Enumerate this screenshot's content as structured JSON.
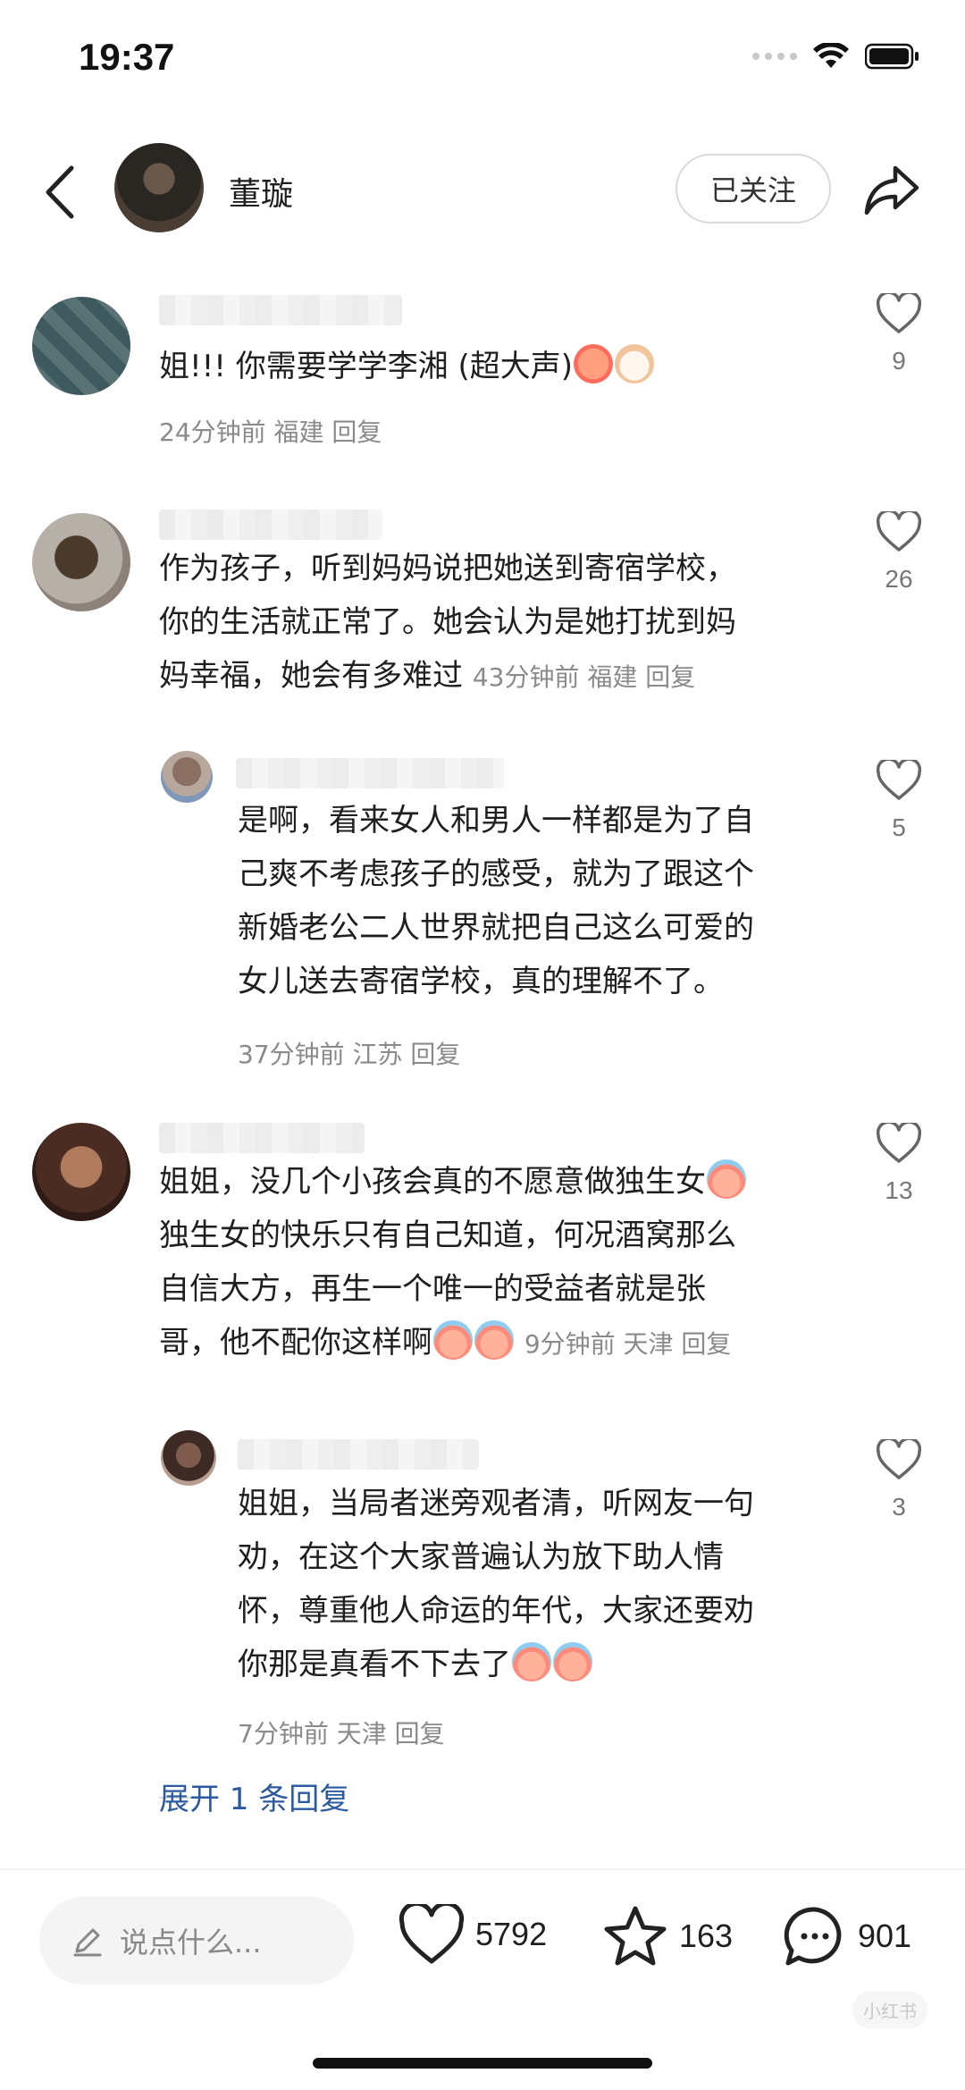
{
  "status_bar": {
    "time": "19:37"
  },
  "header": {
    "user_name": "董璇",
    "follow_label": "已关注"
  },
  "comments": [
    {
      "text_lines": [
        "姐!!! 你需要学学李湘 (超大声)"
      ],
      "meta": "24分钟前 福建 回复",
      "likes": "9",
      "emojis": [
        "tease-face",
        "crying-cat"
      ]
    },
    {
      "text_lines": [
        "作为孩子，听到妈妈说把她送到寄宿学校，",
        "你的生活就正常了。她会认为是她打扰到妈",
        "妈幸福，她会有多难过"
      ],
      "meta": "43分钟前 福建 回复",
      "likes": "26"
    },
    {
      "text_lines": [
        "是啊，看来女人和男人一样都是为了自",
        "己爽不考虑孩子的感受，就为了跟这个",
        "新婚老公二人世界就把自己这么可爱的",
        "女儿送去寄宿学校，真的理解不了。"
      ],
      "meta": "37分钟前 江苏 回复",
      "likes": "5"
    },
    {
      "text_lines": [
        "姐姐，没几个小孩会真的不愿意做独生女",
        "独生女的快乐只有自己知道，何况酒窝那么",
        "自信大方，再生一个唯一的受益者就是张",
        "哥，他不配你这样啊"
      ],
      "meta": "9分钟前 天津 回复",
      "likes": "13",
      "emojis": [
        "crying-face"
      ]
    },
    {
      "text_lines": [
        "姐姐，当局者迷旁观者清，听网友一句",
        "劝，在这个大家普遍认为放下助人情",
        "怀，尊重他人命运的年代，大家还要劝",
        "你那是真看不下去了"
      ],
      "meta": "7分钟前 天津 回复",
      "likes": "3",
      "emojis": [
        "crying-face"
      ]
    }
  ],
  "expand_label": "展开 1 条回复",
  "bottom_bar": {
    "input_placeholder": "说点什么...",
    "likes": "5792",
    "favorites": "163",
    "comments": "901"
  },
  "watermark": "小红书",
  "icons": [
    "back-arrow-icon",
    "share-icon",
    "heart-icon",
    "star-icon",
    "chat-bubble-icon",
    "pencil-icon",
    "wifi-icon",
    "battery-icon"
  ]
}
